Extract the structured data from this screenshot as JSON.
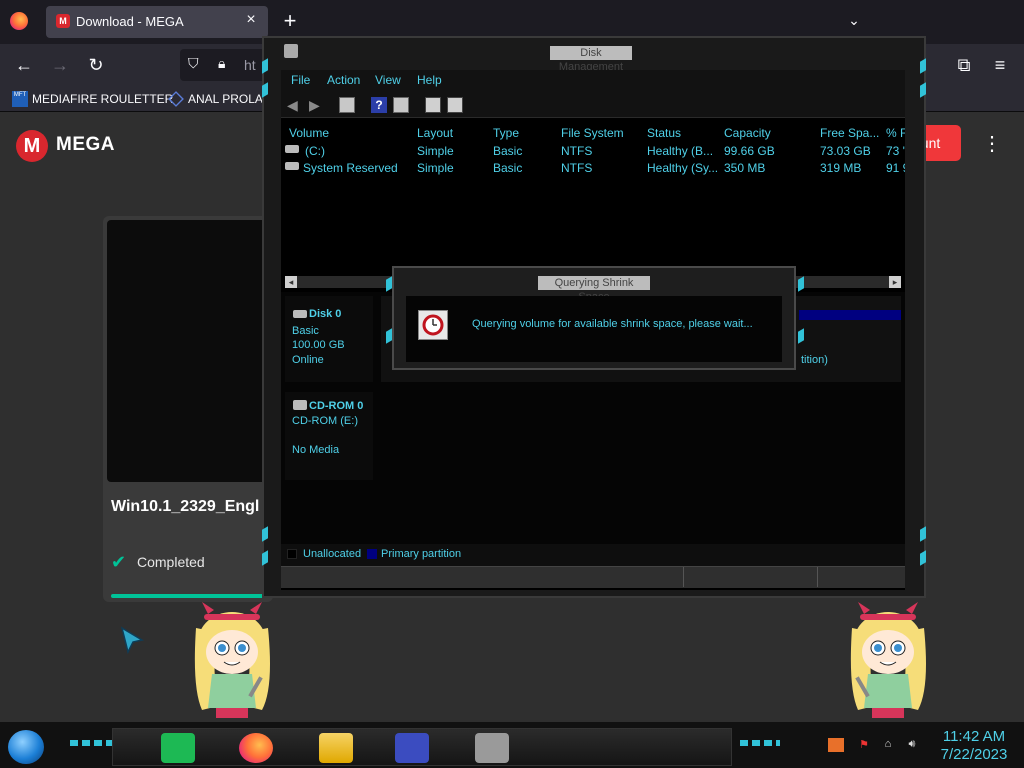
{
  "browser": {
    "tab_title": "Download - MEGA",
    "tab_favicon": "M",
    "url_partial": "ht",
    "bookmarks": [
      {
        "label": "MEDIAFIRE ROULETTER",
        "icon": "MFT"
      },
      {
        "label": "ANAL PROLA",
        "icon": "triangle-icon"
      }
    ]
  },
  "mega": {
    "brand": "MEGA",
    "logo_letter": "M",
    "account_button": "ount",
    "file_name": "Win10.1_2329_Engl",
    "status": "Completed",
    "progress_percent": 100
  },
  "disk_management": {
    "title": "Disk Management",
    "menu": [
      "File",
      "Action",
      "View",
      "Help"
    ],
    "columns": [
      "Volume",
      "Layout",
      "Type",
      "File System",
      "Status",
      "Capacity",
      "Free Spa...",
      "% F"
    ],
    "volumes": [
      {
        "volume": "(C:)",
        "layout": "Simple",
        "type": "Basic",
        "fs": "NTFS",
        "status": "Healthy (B...",
        "capacity": "99.66 GB",
        "free": "73.03 GB",
        "pct": "73 '"
      },
      {
        "volume": "System Reserved",
        "layout": "Simple",
        "type": "Basic",
        "fs": "NTFS",
        "status": "Healthy (Sy...",
        "capacity": "350 MB",
        "free": "319 MB",
        "pct": "91 9"
      }
    ],
    "disks": [
      {
        "name": "Disk 0",
        "type": "Basic",
        "size": "100.00 GB",
        "state": "Online"
      },
      {
        "name": "CD-ROM 0",
        "type": "CD-ROM (E:)",
        "size": "",
        "state": "No Media"
      }
    ],
    "partition_fragment": "tition)",
    "legend": [
      {
        "label": "Unallocated",
        "color": "#000000"
      },
      {
        "label": "Primary partition",
        "color": "#000080"
      }
    ]
  },
  "dialog": {
    "title": "Querying Shrink Space",
    "message": "Querying volume for available shrink space, please wait..."
  },
  "taskbar": {
    "time": "11:42 AM",
    "date": "7/22/2023"
  },
  "colors": {
    "accent_cyan": "#4fd0e8",
    "mega_red": "#d9272e",
    "mega_green": "#00c398",
    "primary_partition": "#000080"
  }
}
